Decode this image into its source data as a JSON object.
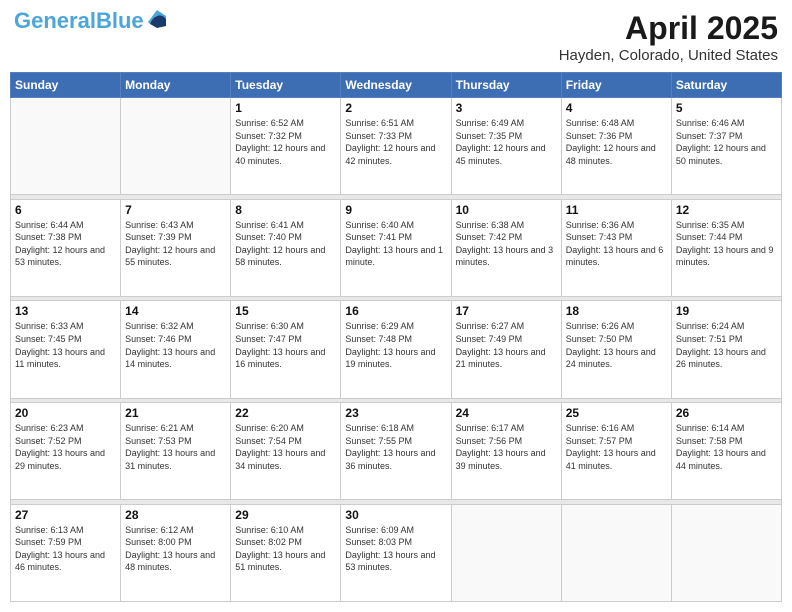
{
  "header": {
    "logo": {
      "name_part1": "General",
      "name_part2": "Blue"
    },
    "title": "April 2025",
    "subtitle": "Hayden, Colorado, United States"
  },
  "days_of_week": [
    "Sunday",
    "Monday",
    "Tuesday",
    "Wednesday",
    "Thursday",
    "Friday",
    "Saturday"
  ],
  "weeks": [
    [
      {
        "day": "",
        "info": ""
      },
      {
        "day": "",
        "info": ""
      },
      {
        "day": "1",
        "info": "Sunrise: 6:52 AM\nSunset: 7:32 PM\nDaylight: 12 hours and 40 minutes."
      },
      {
        "day": "2",
        "info": "Sunrise: 6:51 AM\nSunset: 7:33 PM\nDaylight: 12 hours and 42 minutes."
      },
      {
        "day": "3",
        "info": "Sunrise: 6:49 AM\nSunset: 7:35 PM\nDaylight: 12 hours and 45 minutes."
      },
      {
        "day": "4",
        "info": "Sunrise: 6:48 AM\nSunset: 7:36 PM\nDaylight: 12 hours and 48 minutes."
      },
      {
        "day": "5",
        "info": "Sunrise: 6:46 AM\nSunset: 7:37 PM\nDaylight: 12 hours and 50 minutes."
      }
    ],
    [
      {
        "day": "6",
        "info": "Sunrise: 6:44 AM\nSunset: 7:38 PM\nDaylight: 12 hours and 53 minutes."
      },
      {
        "day": "7",
        "info": "Sunrise: 6:43 AM\nSunset: 7:39 PM\nDaylight: 12 hours and 55 minutes."
      },
      {
        "day": "8",
        "info": "Sunrise: 6:41 AM\nSunset: 7:40 PM\nDaylight: 12 hours and 58 minutes."
      },
      {
        "day": "9",
        "info": "Sunrise: 6:40 AM\nSunset: 7:41 PM\nDaylight: 13 hours and 1 minute."
      },
      {
        "day": "10",
        "info": "Sunrise: 6:38 AM\nSunset: 7:42 PM\nDaylight: 13 hours and 3 minutes."
      },
      {
        "day": "11",
        "info": "Sunrise: 6:36 AM\nSunset: 7:43 PM\nDaylight: 13 hours and 6 minutes."
      },
      {
        "day": "12",
        "info": "Sunrise: 6:35 AM\nSunset: 7:44 PM\nDaylight: 13 hours and 9 minutes."
      }
    ],
    [
      {
        "day": "13",
        "info": "Sunrise: 6:33 AM\nSunset: 7:45 PM\nDaylight: 13 hours and 11 minutes."
      },
      {
        "day": "14",
        "info": "Sunrise: 6:32 AM\nSunset: 7:46 PM\nDaylight: 13 hours and 14 minutes."
      },
      {
        "day": "15",
        "info": "Sunrise: 6:30 AM\nSunset: 7:47 PM\nDaylight: 13 hours and 16 minutes."
      },
      {
        "day": "16",
        "info": "Sunrise: 6:29 AM\nSunset: 7:48 PM\nDaylight: 13 hours and 19 minutes."
      },
      {
        "day": "17",
        "info": "Sunrise: 6:27 AM\nSunset: 7:49 PM\nDaylight: 13 hours and 21 minutes."
      },
      {
        "day": "18",
        "info": "Sunrise: 6:26 AM\nSunset: 7:50 PM\nDaylight: 13 hours and 24 minutes."
      },
      {
        "day": "19",
        "info": "Sunrise: 6:24 AM\nSunset: 7:51 PM\nDaylight: 13 hours and 26 minutes."
      }
    ],
    [
      {
        "day": "20",
        "info": "Sunrise: 6:23 AM\nSunset: 7:52 PM\nDaylight: 13 hours and 29 minutes."
      },
      {
        "day": "21",
        "info": "Sunrise: 6:21 AM\nSunset: 7:53 PM\nDaylight: 13 hours and 31 minutes."
      },
      {
        "day": "22",
        "info": "Sunrise: 6:20 AM\nSunset: 7:54 PM\nDaylight: 13 hours and 34 minutes."
      },
      {
        "day": "23",
        "info": "Sunrise: 6:18 AM\nSunset: 7:55 PM\nDaylight: 13 hours and 36 minutes."
      },
      {
        "day": "24",
        "info": "Sunrise: 6:17 AM\nSunset: 7:56 PM\nDaylight: 13 hours and 39 minutes."
      },
      {
        "day": "25",
        "info": "Sunrise: 6:16 AM\nSunset: 7:57 PM\nDaylight: 13 hours and 41 minutes."
      },
      {
        "day": "26",
        "info": "Sunrise: 6:14 AM\nSunset: 7:58 PM\nDaylight: 13 hours and 44 minutes."
      }
    ],
    [
      {
        "day": "27",
        "info": "Sunrise: 6:13 AM\nSunset: 7:59 PM\nDaylight: 13 hours and 46 minutes."
      },
      {
        "day": "28",
        "info": "Sunrise: 6:12 AM\nSunset: 8:00 PM\nDaylight: 13 hours and 48 minutes."
      },
      {
        "day": "29",
        "info": "Sunrise: 6:10 AM\nSunset: 8:02 PM\nDaylight: 13 hours and 51 minutes."
      },
      {
        "day": "30",
        "info": "Sunrise: 6:09 AM\nSunset: 8:03 PM\nDaylight: 13 hours and 53 minutes."
      },
      {
        "day": "",
        "info": ""
      },
      {
        "day": "",
        "info": ""
      },
      {
        "day": "",
        "info": ""
      }
    ]
  ]
}
